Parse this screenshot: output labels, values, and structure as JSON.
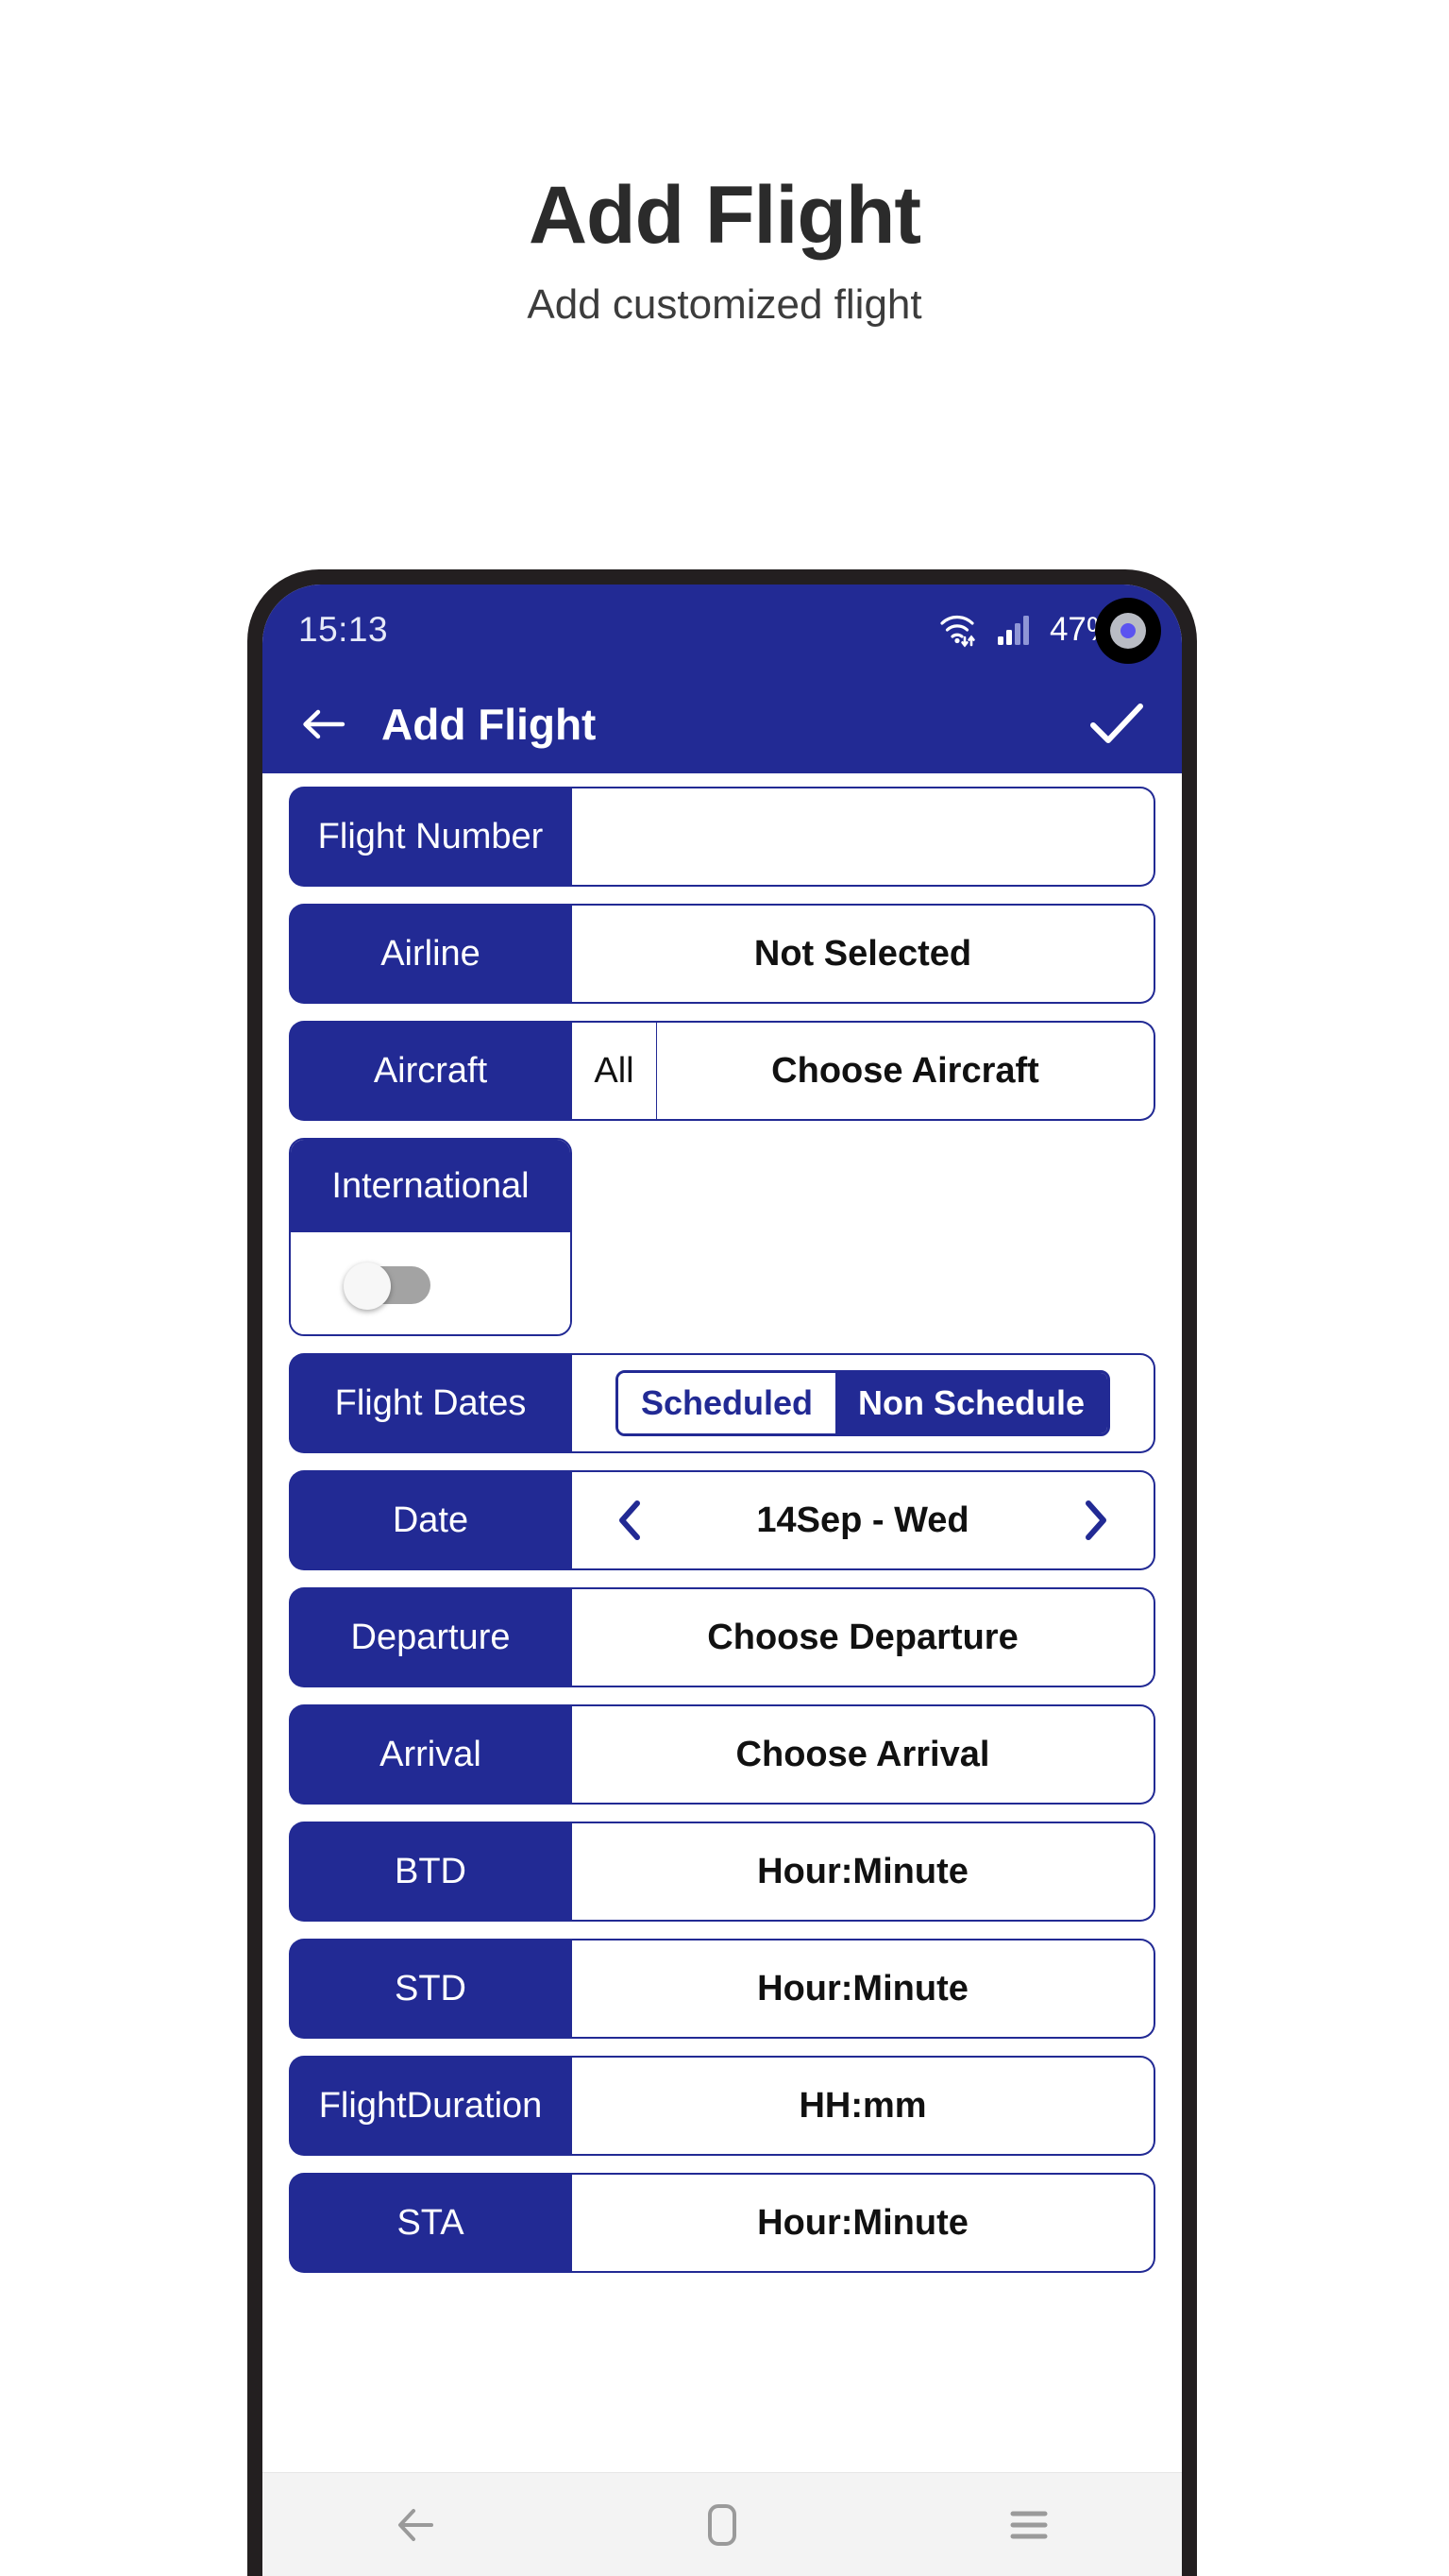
{
  "page": {
    "title": "Add Flight",
    "subtitle": "Add customized flight"
  },
  "status_bar": {
    "time": "15:13",
    "battery_percent": "47%",
    "wifi_icon": "wifi-arrows-icon",
    "signal_icon": "cellular-signal-icon",
    "battery_icon": "battery-icon",
    "camera_icon": "front-camera-punch-hole"
  },
  "app_bar": {
    "back_icon": "arrow-left-icon",
    "title": "Add Flight",
    "confirm_icon": "check-icon",
    "background_color": "#222a94"
  },
  "form": {
    "rows": [
      {
        "label": "Flight Number",
        "value": "",
        "type": "text-input"
      },
      {
        "label": "Airline",
        "value": "Not Selected",
        "type": "selector"
      },
      {
        "label": "Aircraft",
        "segment": "All",
        "value": "Choose Aircraft",
        "type": "selector-with-segment"
      },
      {
        "label": "International",
        "toggle_on": false,
        "type": "toggle"
      },
      {
        "label": "Flight Dates",
        "options": [
          "Scheduled",
          "Non Schedule"
        ],
        "selected": "Non Schedule",
        "type": "segmented"
      },
      {
        "label": "Date",
        "value": "14Sep - Wed",
        "prev_icon": "chevron-left-icon",
        "next_icon": "chevron-right-icon",
        "type": "stepper"
      },
      {
        "label": "Departure",
        "value": "Choose Departure",
        "type": "selector"
      },
      {
        "label": "Arrival",
        "value": "Choose Arrival",
        "type": "selector"
      },
      {
        "label": "BTD",
        "value": "Hour:Minute",
        "type": "time"
      },
      {
        "label": "STD",
        "value": "Hour:Minute",
        "type": "time"
      },
      {
        "label": "FlightDuration",
        "value": "HH:mm",
        "type": "time"
      },
      {
        "label": "STA",
        "value": "Hour:Minute",
        "type": "time"
      }
    ]
  },
  "nav_bar": {
    "back_icon": "android-back-icon",
    "home_icon": "android-home-icon",
    "recents_icon": "android-recents-icon"
  },
  "colors": {
    "brand_blue": "#222a94",
    "frame_black": "#231f20",
    "nav_gray": "#f3f3f3"
  }
}
